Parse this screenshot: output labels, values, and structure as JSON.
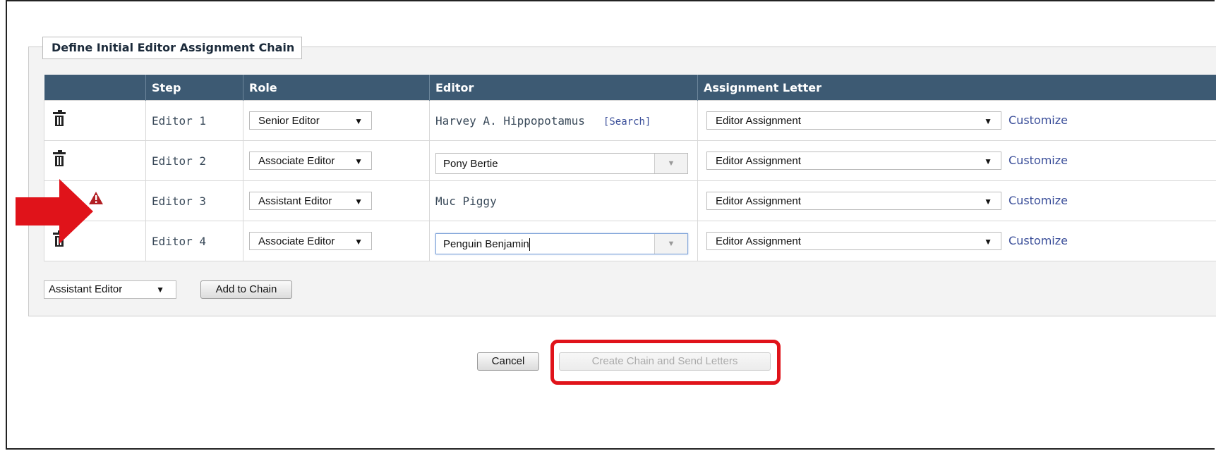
{
  "panel": {
    "legend": "Define Initial Editor Assignment Chain"
  },
  "table": {
    "headers": {
      "icon": "",
      "step": "Step",
      "role": "Role",
      "editor": "Editor",
      "letter": "Assignment Letter"
    },
    "rows": [
      {
        "icon": "trash-icon",
        "step": "Editor 1",
        "role": "Senior Editor",
        "editor_text": "Harvey A. Hippopotamus",
        "editor_link": "[Search]",
        "letter": "Editor Assignment",
        "customize": "Customize"
      },
      {
        "icon": "trash-icon",
        "step": "Editor 2",
        "role": "Associate Editor",
        "editor_value": "Pony Bertie",
        "letter": "Editor Assignment",
        "customize": "Customize"
      },
      {
        "icon": "warning-icon",
        "step": "Editor 3",
        "role": "Assistant Editor",
        "editor_text": "Muc Piggy",
        "letter": "Editor Assignment",
        "customize": "Customize"
      },
      {
        "icon": "trash-icon",
        "step": "Editor 4",
        "role": "Associate Editor",
        "editor_value": "Penguin Benjamin",
        "letter": "Editor Assignment",
        "customize": "Customize"
      }
    ]
  },
  "add_chain": {
    "role_select": "Assistant Editor",
    "add_button": "Add to Chain"
  },
  "actions": {
    "cancel": "Cancel",
    "create": "Create Chain and Send Letters"
  },
  "colors": {
    "header_bg": "#3d5a73",
    "link": "#3b4f9a",
    "warning": "#b21f24",
    "annotation_red": "#e0131a"
  }
}
